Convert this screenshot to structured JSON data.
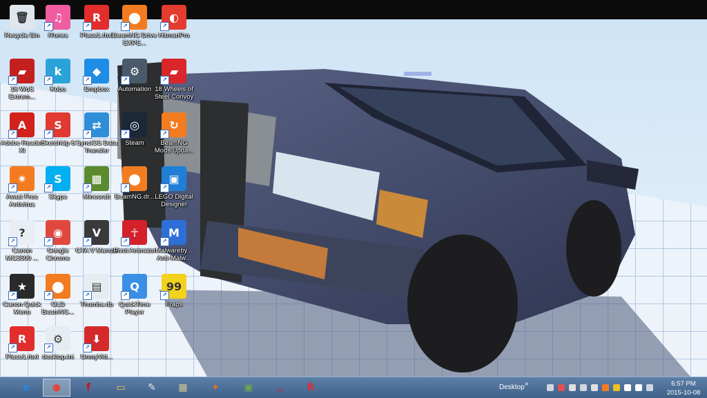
{
  "desktop": {
    "icons": [
      {
        "label": "Recycle Bin",
        "icon": "recycle-bin-icon",
        "color": "#dfe6ee"
      },
      {
        "label": "iTunes",
        "icon": "itunes-icon",
        "color": "#f05ca0"
      },
      {
        "label": "Place1.rbxl",
        "icon": "roblox-file-icon",
        "color": "#e22d2d"
      },
      {
        "label": "BeamNG Drive EXPE...",
        "icon": "beamng-icon",
        "color": "#f47c20"
      },
      {
        "label": "HitmanPro",
        "icon": "hitmanpro-icon",
        "color": "#e33b2e"
      },
      {
        "label": "18 WoS Extrem...",
        "icon": "truck-icon",
        "color": "#c52020"
      },
      {
        "label": "Kobo",
        "icon": "kobo-icon",
        "color": "#2aa4d8"
      },
      {
        "label": "Dropbox",
        "icon": "dropbox-icon",
        "color": "#1f8ce6"
      },
      {
        "label": "Automation",
        "icon": "automation-icon",
        "color": "#4a5a6a"
      },
      {
        "label": "18 Wheels of Steel Convoy",
        "icon": "truck-convoy-icon",
        "color": "#d8262a"
      },
      {
        "label": "Adobe Reader XI",
        "icon": "adobe-reader-icon",
        "color": "#d1221b"
      },
      {
        "label": "SketchUp 8",
        "icon": "sketchup-icon",
        "color": "#e03a32"
      },
      {
        "label": "SynciOS Data Transfer",
        "icon": "syncios-icon",
        "color": "#2f8ed8"
      },
      {
        "label": "Steam",
        "icon": "steam-icon",
        "color": "#1b2838"
      },
      {
        "label": "BeamNG Mods Upda...",
        "icon": "beamng-mods-icon",
        "color": "#f47c20"
      },
      {
        "label": "Avast Free Antivirus",
        "icon": "avast-icon",
        "color": "#f47b20"
      },
      {
        "label": "Skype",
        "icon": "skype-icon",
        "color": "#00aff0"
      },
      {
        "label": "Minecraft",
        "icon": "minecraft-icon",
        "color": "#5c8a2f"
      },
      {
        "label": "BeamNG.dr...",
        "icon": "beamng-drive-icon",
        "color": "#f47c20"
      },
      {
        "label": "LEGO Digital Designer",
        "icon": "lego-icon",
        "color": "#1f7fd6"
      },
      {
        "label": "Canon MG3500 ...",
        "icon": "canon-printer-icon",
        "color": "#e8eef4"
      },
      {
        "label": "Google Chrome",
        "icon": "chrome-icon",
        "color": "#e0483e"
      },
      {
        "label": "GTA V Manual",
        "icon": "gta-v-icon",
        "color": "#3a3a3a"
      },
      {
        "label": "Pivot Animator",
        "icon": "pivot-animator-icon",
        "color": "#d4202a"
      },
      {
        "label": "Malwareby... Anti-Malw...",
        "icon": "malwarebytes-icon",
        "color": "#2d6fd6"
      },
      {
        "label": "Canon Quick Menu",
        "icon": "canon-quick-menu-icon",
        "color": "#2a2a2a"
      },
      {
        "label": "OLD BeamNG...",
        "icon": "old-beamng-icon",
        "color": "#f47c20"
      },
      {
        "label": "Thumbs.db",
        "icon": "thumbs-db-icon",
        "color": "#e6ecf2"
      },
      {
        "label": "QuickTime Player",
        "icon": "quicktime-icon",
        "color": "#3a8ee6"
      },
      {
        "label": "Fraps",
        "icon": "fraps-icon",
        "color": "#f2d21a"
      },
      {
        "label": "Place1.rbxl",
        "icon": "roblox-file-icon",
        "color": "#e22d2d"
      },
      {
        "label": "desktop.ini",
        "icon": "ini-file-icon",
        "color": "#e6ecf2"
      },
      {
        "label": "UnmyVid...",
        "icon": "unmyvid-icon",
        "color": "#d42a2a"
      }
    ]
  },
  "taskbar": {
    "pinned": [
      {
        "icon": "internet-explorer-icon",
        "glyph": "e",
        "color": "#2a8be0"
      },
      {
        "icon": "chrome-icon",
        "glyph": "●",
        "color": "#e0483e"
      },
      {
        "icon": "flash-icon",
        "glyph": "f",
        "color": "#c8141e"
      },
      {
        "icon": "file-explorer-icon",
        "glyph": "▭",
        "color": "#f2c84a"
      },
      {
        "icon": "paint-icon",
        "glyph": "✎",
        "color": "#e6e6e6"
      },
      {
        "icon": "control-panel-icon",
        "glyph": "▦",
        "color": "#d8c890"
      },
      {
        "icon": "wlm-icon",
        "glyph": "✦",
        "color": "#e07020"
      },
      {
        "icon": "beamng-taskbar-icon",
        "glyph": "▣",
        "color": "#6aa84f"
      },
      {
        "icon": "mustache-icon",
        "glyph": "◡",
        "color": "#d41e28"
      },
      {
        "icon": "roblox-taskbar-icon",
        "glyph": "R",
        "color": "#e22d2d"
      }
    ],
    "desktop_label": "Desktop",
    "chevron": "»",
    "tray_icons": [
      "network-icon",
      "volume-icon",
      "flag-icon",
      "display-icon",
      "printer-icon",
      "avast-tray-icon",
      "battery-icon",
      "signal-icon",
      "speaker-icon",
      "keyboard-icon"
    ],
    "clock_time": "6:57 PM",
    "clock_date": "2015-10-08"
  }
}
